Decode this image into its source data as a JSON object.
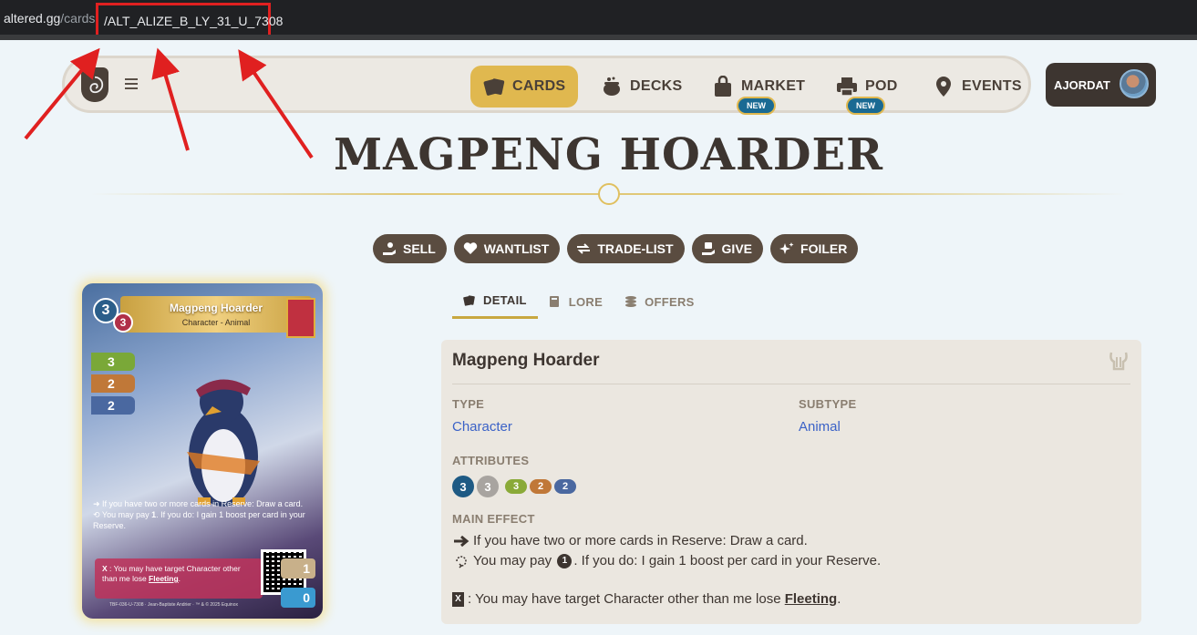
{
  "browser": {
    "host": "altered.gg",
    "path": "/cards",
    "slug": "/ALT_ALIZE_B_LY_31_U_7308"
  },
  "nav": {
    "menu_icon": "hamburger-icon",
    "items": [
      {
        "label": "CARDS",
        "icon": "cards-icon",
        "active": true
      },
      {
        "label": "DECKS",
        "icon": "cauldron-icon",
        "active": false
      },
      {
        "label": "MARKET",
        "icon": "bag-icon",
        "badge": "NEW"
      },
      {
        "label": "POD",
        "icon": "printer-icon",
        "badge": "NEW"
      },
      {
        "label": "EVENTS",
        "icon": "location-pin-icon"
      }
    ],
    "user": "AJORDAT"
  },
  "page": {
    "title": "MAGPENG HOARDER"
  },
  "actions": [
    {
      "label": "SELL",
      "icon": "sell-icon"
    },
    {
      "label": "WANTLIST",
      "icon": "heart-icon"
    },
    {
      "label": "TRADE-LIST",
      "icon": "trade-icon"
    },
    {
      "label": "GIVE",
      "icon": "give-icon"
    },
    {
      "label": "FOILER",
      "icon": "sparkle-icon"
    }
  ],
  "card": {
    "name": "Magpeng Hoarder",
    "subtitle": "Character - Animal",
    "hand_cost": "3",
    "reserve_cost": "3",
    "forest": "3",
    "mountain": "2",
    "ocean": "2",
    "effect1": "If you have two or more cards in Reserve: Draw a card.",
    "effect2a": "You may pay",
    "effect2_cost": "1",
    "effect2b": ". If you do: I gain 1 boost per card in your Reserve.",
    "support_key": "X",
    "support": ": You may have target Character other than me lose",
    "support_kw": "Fleeting",
    "support_end": ".",
    "counter1": "1",
    "counter2": "0",
    "footer": "TBF-036-U-7308 · Jean-Baptiste Andrier · ™ & © 2025 Equinox"
  },
  "tabs": [
    {
      "label": "DETAIL",
      "icon": "cards-icon",
      "active": true
    },
    {
      "label": "LORE",
      "icon": "book-icon"
    },
    {
      "label": "OFFERS",
      "icon": "coins-icon"
    }
  ],
  "detail": {
    "name": "Magpeng Hoarder",
    "type_label": "TYPE",
    "type_value": "Character",
    "subtype_label": "SUBTYPE",
    "subtype_value": "Animal",
    "attributes_label": "ATTRIBUTES",
    "attributes": {
      "hand": "3",
      "reserve": "3",
      "forest": "3",
      "mountain": "2",
      "ocean": "2"
    },
    "main_effect_label": "MAIN EFFECT",
    "effect1": "If you have two or more cards in Reserve: Draw a card.",
    "effect2a": "You may pay",
    "effect2_cost": "1",
    "effect2b": ". If you do: I gain 1 boost per card in your Reserve.",
    "support_key": "X",
    "support": ": You may have target Character other than me lose",
    "support_kw": "Fleeting",
    "support_end": "."
  },
  "colors": {
    "accent": "#e0b84f",
    "dark": "#3d3530",
    "link": "#3b62c7",
    "annotation": "#e02020"
  }
}
